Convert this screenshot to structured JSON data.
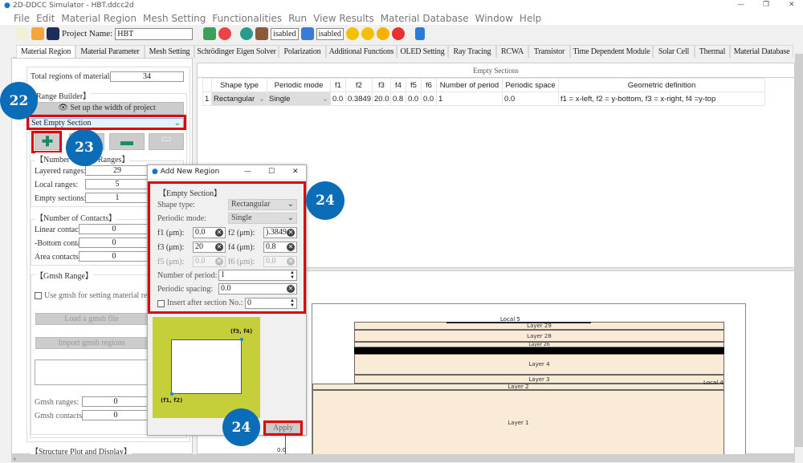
{
  "window": {
    "title": "2D-DDCC Simulator - HBT.ddcc2d",
    "minimize": "—",
    "restore": "❐",
    "close": "✕"
  },
  "menu": [
    "File",
    "Edit",
    "Material Region",
    "Mesh Setting",
    "Functionalities",
    "Run",
    "View Results",
    "Material Database",
    "Window",
    "Help"
  ],
  "toolbar": {
    "project_label": "Project Name:",
    "project_name": "HBT",
    "disabled1": "isabled",
    "disabled2": "isabled"
  },
  "tabs": [
    "Material Region",
    "Material Parameter",
    "Mesh Setting",
    "Schrödinger Eigen Solver",
    "Polarization",
    "Additional Functions",
    "OLED Setting",
    "Ray Tracing",
    "RCWA",
    "Transistor",
    "Time Dependent Module",
    "Solar Cell",
    "Thermal",
    "Material Database"
  ],
  "left": {
    "total_label": "Total regions of materials:",
    "total_value": "34",
    "range_builder": "Range Builder】",
    "setup_width": "Set up the width of project",
    "section_select": "Set Empty Section",
    "num_ranges": "【Number o",
    "num_ranges_tail": "Ranges】",
    "layered_label": "Layered ranges:",
    "layered_value": "29",
    "local_label": "Local ranges:",
    "local_value": "5",
    "empty_label": "Empty sections:",
    "empty_value": "1",
    "contacts_title": "【Number of Contacts】",
    "linear_label": "Linear contact",
    "linear_value": "0",
    "bottom_label": "-Bottom conta",
    "bottom_value": "0",
    "area_label": "Area contacts:",
    "area_value": "0",
    "gmsh_title": "【Gmsh Range】",
    "gmsh_check": "Use gmsh for setting material regio",
    "load_gmsh": "Load a gmsh file",
    "import_gmsh": "Import gmsh regions",
    "gmsh_ranges_label": "Gmsh ranges:",
    "gmsh_ranges_value": "0",
    "gmsh_contacts_label": "Gmsh contacts:",
    "gmsh_contacts_value": "0",
    "structure_title": "【Structure Plot and Display】"
  },
  "callouts": [
    "22",
    "23",
    "24",
    "24"
  ],
  "table": {
    "title": "Empty Sections",
    "headers": [
      "",
      "Shape type",
      "Periodic mode",
      "f1",
      "f2",
      "f3",
      "f4",
      "f5",
      "f6",
      "Number of period",
      "Periodic space",
      "Geometric definition"
    ],
    "rows": [
      [
        "1",
        "Rectangular",
        "Single",
        "0.0",
        "0.3849",
        "20.0",
        "0.8",
        "0.0",
        "0.0",
        "1",
        "0.0",
        "f1 = x-left, f2 = y-bottom, f3 = x-right, f4 =y-top"
      ]
    ]
  },
  "dialog": {
    "title": "Add New Region",
    "group": "【Empty Section】",
    "shape_label": "Shape type:",
    "shape_value": "Rectangular",
    "periodic_label": "Periodic mode:",
    "periodic_value": "Single",
    "f1_label": "f1 (μm):",
    "f1": "0.0",
    "f2_label": "f2 (μm):",
    "f2": ").3849",
    "f3_label": "f3 (μm):",
    "f3": "20",
    "f4_label": "f4 (μm):",
    "f4": "0.8",
    "f5_label": "f5 (μm):",
    "f5": "0.0",
    "f6_label": "f6 (μm):",
    "f6": "0.0",
    "nperiod_label": "Number of period:",
    "nperiod": "1",
    "spacing_label": "Periodic spacing:",
    "spacing": "0.0",
    "insert_label": "Insert after section No.:",
    "insert": "0",
    "pt1": "(f1, f2)",
    "pt2": "(f3, f4)",
    "apply": "Apply"
  },
  "plot": {
    "ytick": "0.0",
    "layers": [
      "Layer 29",
      "Layer 28",
      "Layer 26",
      "Layer 4",
      "Layer 3",
      "Layer 2",
      "Layer 1"
    ],
    "locals": [
      "Local 5",
      "Local 4"
    ]
  }
}
